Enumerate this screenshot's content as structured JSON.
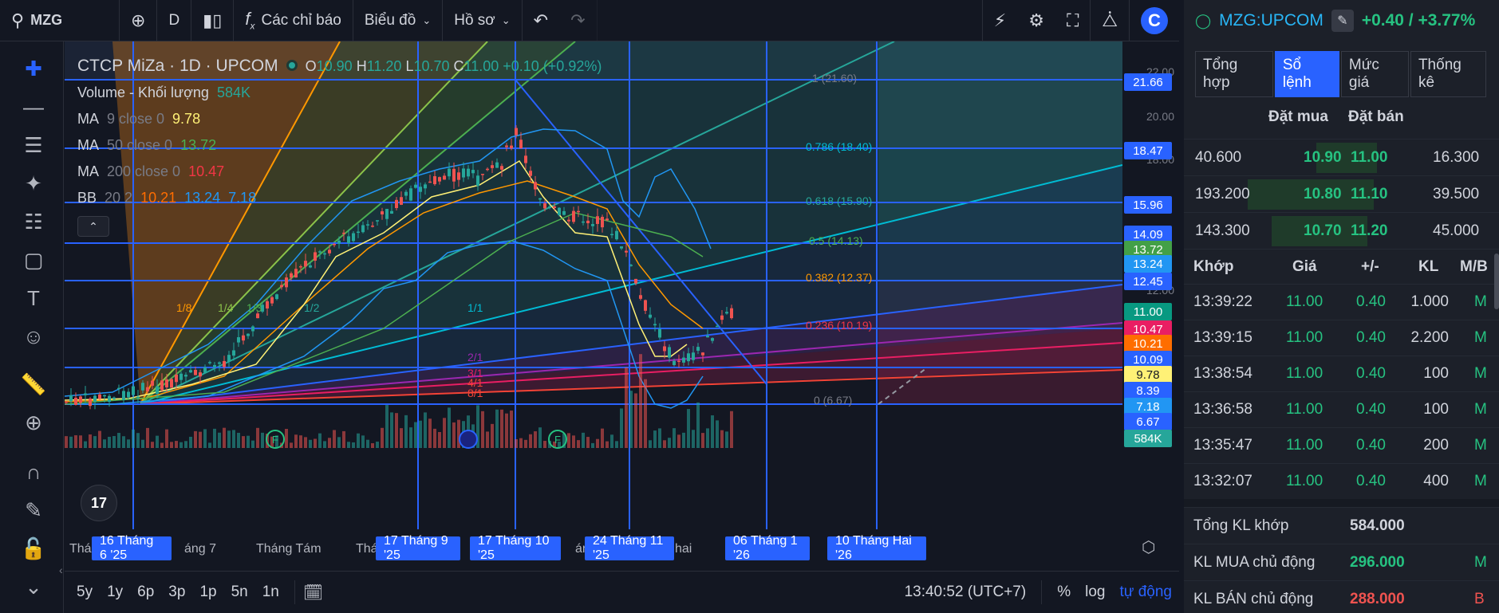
{
  "toolbar": {
    "symbol": "MZG",
    "interval": "D",
    "indicators_label": "Các chỉ báo",
    "chart_label": "Biểu đồ",
    "profile_label": "Hồ sơ",
    "logo_letter": "C"
  },
  "legend": {
    "title": "CTCP MiZa · 1D · UPCOM",
    "ohlc": {
      "o_k": "O",
      "o": "10.90",
      "h_k": "H",
      "h": "11.20",
      "l_k": "L",
      "l": "10.70",
      "c_k": "C",
      "c": "11.00",
      "chg": "+0.10 (+0.92%)"
    },
    "volume": {
      "label": "Volume - Khối lượng",
      "value": "584K"
    },
    "ma9": {
      "label": "MA",
      "sub": "9 close 0",
      "value": "9.78"
    },
    "ma50": {
      "label": "MA",
      "sub": "50 close 0",
      "value": "13.72"
    },
    "ma200": {
      "label": "MA",
      "sub": "200 close 0",
      "value": "10.47"
    },
    "bb": {
      "label": "BB",
      "sub": "20 2",
      "v1": "10.21",
      "v2": "13.24",
      "v3": "7.18"
    }
  },
  "fib_labels": [
    "1 (21.60)",
    "0.786 (18.40)",
    "0.618 (15.90)",
    "0.5 (14.13)",
    "0.382 (12.37)",
    "0.236 (10.19)",
    "0 (6.67)"
  ],
  "fan_labels": [
    "1/8",
    "1/4",
    "1/3",
    "1/2",
    "1/1",
    "2/1",
    "3/1",
    "4/1",
    "8/1"
  ],
  "price_axis": [
    "22.00",
    "20.00",
    "18.00",
    "12.00"
  ],
  "price_tags": [
    {
      "v": "21.66",
      "color": "#2962ff"
    },
    {
      "v": "18.47",
      "color": "#2962ff"
    },
    {
      "v": "15.96",
      "color": "#2962ff"
    },
    {
      "v": "14.09",
      "color": "#2962ff"
    },
    {
      "v": "13.72",
      "color": "#43a047"
    },
    {
      "v": "13.24",
      "color": "#2196f3"
    },
    {
      "v": "12.45",
      "color": "#2962ff"
    },
    {
      "v": "11.00",
      "color": "#089981"
    },
    {
      "v": "10.47",
      "color": "#e91e63"
    },
    {
      "v": "10.21",
      "color": "#ff6d00"
    },
    {
      "v": "10.09",
      "color": "#2962ff"
    },
    {
      "v": "9.78",
      "color": "#fff176"
    },
    {
      "v": "8.39",
      "color": "#2962ff"
    },
    {
      "v": "7.18",
      "color": "#2196f3"
    },
    {
      "v": "6.67",
      "color": "#2962ff"
    },
    {
      "v": "584K",
      "color": "#26a69a"
    }
  ],
  "time_axis": {
    "labels": [
      "Thán",
      "áng 7",
      "Tháng Tám",
      "Thán",
      "áng 11",
      "hai"
    ],
    "date_tags": [
      "16 Tháng 6 '25",
      "17 Tháng 9 '25",
      "17 Tháng 10 '25",
      "24 Tháng 11 '25",
      "06 Tháng 1 '26",
      "10 Tháng Hai '26"
    ]
  },
  "bottombar": {
    "ranges": [
      "5y",
      "1y",
      "6p",
      "3p",
      "1p",
      "5n",
      "1n"
    ],
    "clock": "13:40:52 (UTC+7)",
    "percent": "%",
    "log": "log",
    "auto": "tự động"
  },
  "events": [
    "F",
    "F"
  ],
  "panel": {
    "symbol": "MZG:UPCOM",
    "change": "+0.40 / +3.77%",
    "tabs": [
      "Tổng hợp",
      "Sổ lệnh",
      "Mức giá",
      "Thống kê"
    ],
    "orderbook_head": {
      "buy": "Đặt mua",
      "sell": "Đặt bán"
    },
    "orderbook": [
      {
        "bid_vol": "40.600",
        "bid": "10.90",
        "ask": "11.00",
        "ask_vol": "16.300"
      },
      {
        "bid_vol": "193.200",
        "bid": "10.80",
        "ask": "11.10",
        "ask_vol": "39.500"
      },
      {
        "bid_vol": "143.300",
        "bid": "10.70",
        "ask": "11.20",
        "ask_vol": "45.000"
      }
    ],
    "trades_head": {
      "time": "Khớp",
      "price": "Giá",
      "chg": "+/-",
      "vol": "KL",
      "side": "M/B"
    },
    "trades": [
      {
        "time": "13:39:22",
        "price": "11.00",
        "chg": "0.40",
        "vol": "1.000",
        "side": "M"
      },
      {
        "time": "13:39:15",
        "price": "11.00",
        "chg": "0.40",
        "vol": "2.200",
        "side": "M"
      },
      {
        "time": "13:38:54",
        "price": "11.00",
        "chg": "0.40",
        "vol": "100",
        "side": "M"
      },
      {
        "time": "13:36:58",
        "price": "11.00",
        "chg": "0.40",
        "vol": "100",
        "side": "M"
      },
      {
        "time": "13:35:47",
        "price": "11.00",
        "chg": "0.40",
        "vol": "200",
        "side": "M"
      },
      {
        "time": "13:32:07",
        "price": "11.00",
        "chg": "0.40",
        "vol": "400",
        "side": "M"
      }
    ],
    "summary": [
      {
        "label": "Tổng KL khớp",
        "value": "584.000",
        "flag": ""
      },
      {
        "label": "KL MUA chủ động",
        "value": "296.000",
        "flag": "M"
      },
      {
        "label": "KL BÁN chủ động",
        "value": "288.000",
        "flag": "B"
      }
    ]
  }
}
